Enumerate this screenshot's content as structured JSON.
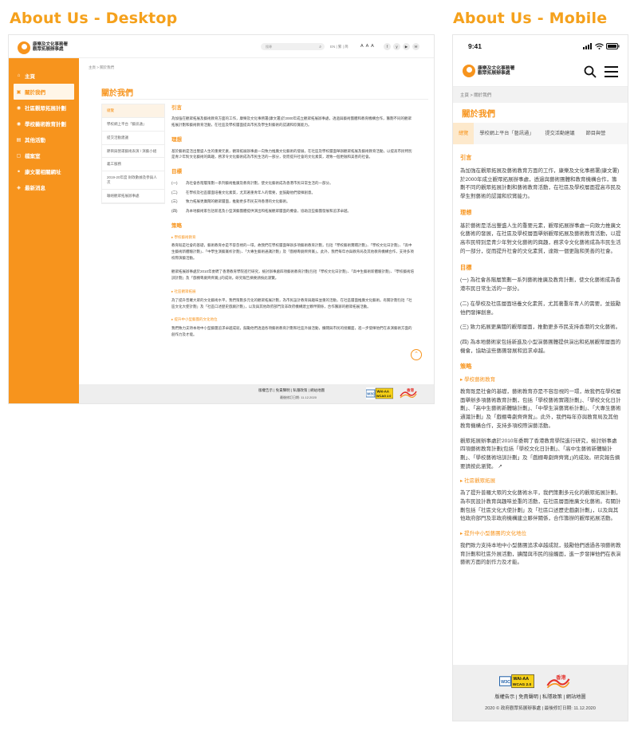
{
  "headings": {
    "desktop": "About Us - Desktop",
    "mobile": "About Us - Mobile"
  },
  "org": {
    "line1": "康樂及文化事務署",
    "line2": "觀眾拓展辦事處"
  },
  "desktop": {
    "search_placeholder": "搜尋",
    "lang": "EN | 繁 | 简",
    "font_size": "A A A",
    "social": [
      "f",
      "y",
      "▶",
      "✉"
    ],
    "nav": [
      {
        "icon": "⌂",
        "label": "主頁"
      },
      {
        "icon": "▣",
        "label": "關於我們"
      },
      {
        "icon": "◉",
        "label": "社區觀眾拓展計劃"
      },
      {
        "icon": "◉",
        "label": "學校藝術教育計劃"
      },
      {
        "icon": "▤",
        "label": "其他活動"
      },
      {
        "icon": "▢",
        "label": "檔案室"
      },
      {
        "icon": "⚭",
        "label": "康文署相關網址"
      },
      {
        "icon": "◈",
        "label": "最新消息"
      }
    ],
    "breadcrumb": "主頁 > 關於我們",
    "page_title": "關於我們",
    "toc": [
      "總覽",
      "學校網上平台「藝訊通」",
      "提交活動建議",
      "節目與營運藝術表演 / 演藝小組",
      "義工服務",
      "2019-20年度 財政數據及參與人次",
      "聯絡觀眾拓展辦事處"
    ],
    "intro_h": "引言",
    "intro": "為加強在觀眾拓展及藝術教育方面的工作，康樂及文化事務署(康文署)於2000年成立觀眾拓展辦事處，透過與藝術團體和教育機構合作，籌劃不同的觀眾拓展計劃和藝術教育活動，在社區及學校層面提高市民及學生對藝術的認識和欣賞能力。",
    "vision_h": "理想",
    "vision": "基於藝術是活出豐盛人生的重要元素，觀眾拓展辦事處一向致力推廣文化藝術的發展，在社區及學校層面舉辦觀眾拓展及藝術教育活動，以提高市民特別是青少年對文化藝術的興趣，務求令文化藝術成為市民生活的一部分，從而提升社會的文化素質，達致一個更融和美善的社會。",
    "obj_h": "目標",
    "objectives": [
      {
        "k": "(一)",
        "t": "為社會各階層策劃一系列藝術推廣及教育計劃，使文化藝術成為香港市民日常生活的一部分。"
      },
      {
        "k": "(二)",
        "t": "在學校及社區層面培養文化素質，尤其著重青年人的需要，並鼓勵他們發揮創意。"
      },
      {
        "k": "(三)",
        "t": "致力拓展更廣闊的觀眾層面，推動更多市民支持香港的文化藝術。"
      },
      {
        "k": "(四)",
        "t": "為本地藝術家包括新進及小型演藝團體提供演出和拓展觀眾層面的機會，協助這些藝團發展和追求卓越。"
      }
    ],
    "strat_h": "策略",
    "strat1_h": "學校藝術教育",
    "strat1_p1": "教育既是社會的基礎，藝術教育亦是不容忽視的一環，故我們在學校層面舉辦多項藝術教育計劃，包括「學校藝術實踐計劃」、「學校文化日計劃」、「高中生藝術新體驗計劃」、「中學生演藝賞析計劃」、「大專生藝術通識計劃」及「戲棚粵劇齊齊賞」。此外，我們每年亦與教育局及其他教育機構合作，支持多項校際演藝活動。",
    "strat1_p2": "觀眾拓展辦事處於2010年委聘了香港教育學院進行研究，檢討辦事處四項藝術教育計劃(包括「學校文化日計劃」、「高中生藝術新體驗計劃」、「學校藝術培訓計劃」及「戲棚粵劇齊齊賞」)的成效。研究報告摘要請按此瀏覽。",
    "strat2_h": "社區觀眾拓展",
    "strat2_p": "為了提升普羅大眾的文化藝術水平，我們策劃多元化的觀眾拓展計劃，為市民設計教育與趣味並重的活動，在社區層面推廣文化藝術。有關計劃包括「社區文化大使計劃」及「社區口述歷史戲劇計劃」，以及與其他政府部門及非政府機構建立夥伴關係，合作籌辦的觀眾拓展活動。",
    "strat3_h": "提升中小型藝團的文化地位",
    "strat3_p": "我們致力支持本地中小型藝團追求卓越成就，鼓勵他們透過各項藝術教育計劃和社區外展活動，擴闊與市民的接觸面，進一步發揮他們在表演藝術方面的創作力及才能。",
    "footer_links": "版權告示 | 免責聲明 | 私隱政策 | 網站地圖",
    "footer_copy": "最後修訂日期: 11.12.2020"
  },
  "mobile": {
    "time": "9:41",
    "breadcrumb": "主頁 > 關於我們",
    "page_title": "關於我們",
    "tabs": [
      "總覽",
      "學校網上平台「藝訊通」",
      "提交活動建議",
      "節目與營"
    ],
    "intro": "為加強在觀眾拓展及藝術教育方面的工作，康樂及文化事務署(康文署)於2000年成立觀眾拓展辦事處，透過與藝術團體和教育機構合作，籌劃不同的觀眾拓展計劃和藝術教育活動，在社區及學校層面提高市民及學生對藝術的認識和欣賞能力。",
    "vision": "基於藝術是活出豐盛人生的重要元素，觀眾拓展辦事處一向致力推廣文化藝術的發展，在社區及學校層面舉辦觀眾拓展及藝術教育活動，以提高市民特別是青少年對文化藝術的興趣，務求令文化藝術成為市民生活的一部分，從而提升社會的文化素質，達致一個更融和美善的社會。",
    "objectives": [
      "(一) 為社會各階層策劃一系列藝術推廣及教育計劃，使文化藝術成為香港市民日常生活的一部分。",
      "(二) 在學校及社區層面培養文化素質，尤其著重年青人的需要，並鼓勵他們發揮創意。",
      "(三) 致力拓展更廣闊的觀眾層面，推動更多市民支持香港的文化藝術。",
      "(四) 為本地藝術家包括新進及小型演藝團體提供演出和拓展觀眾層面的機會，協助這些藝團發展和追求卓越。"
    ],
    "strat1_p2": "觀眾拓展辦事處於2010年委聘了香港教育學院進行研究，檢討辦事處四項藝術教育計劃(包括「學校文化日計劃」、「高中生藝術新體驗計劃」、「學校藝術培訓計劃」及「戲棚粵劇齊齊賞」)的成效。研究報告摘要請按此瀏覽。",
    "footer_links": "版權告示 | 免責聲明 | 私隱政策 | 網站地圖",
    "footer_copy": "2020 © 政府觀眾拓展辦事處 | 最後修訂日期: 11.12.2020"
  },
  "badges": {
    "wcag_top": "WAI-AA",
    "wcag_bottom": "WCAG 2.0",
    "w3c": "W3C",
    "hk": "香港"
  },
  "colors": {
    "accent": "#f7941d",
    "heading": "#f5a11c"
  }
}
